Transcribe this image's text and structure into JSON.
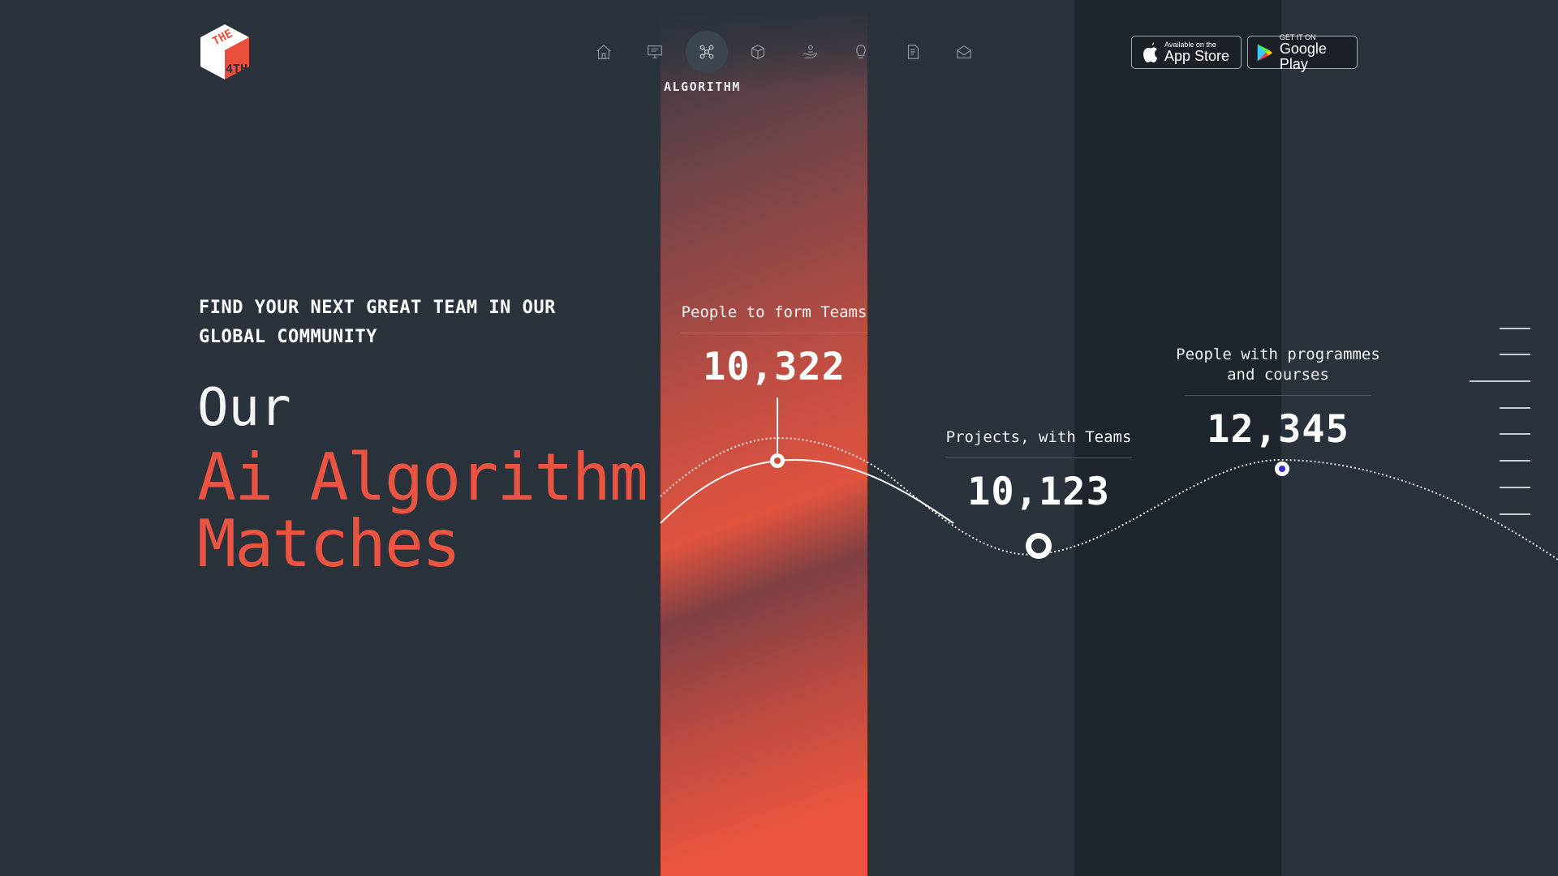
{
  "nav": {
    "items": [
      {
        "icon": "home-icon",
        "label": ""
      },
      {
        "icon": "monitor-icon",
        "label": ""
      },
      {
        "icon": "algorithm-icon",
        "label": "ALGORITHM",
        "active": true
      },
      {
        "icon": "cube-icon",
        "label": ""
      },
      {
        "icon": "hand-user-icon",
        "label": ""
      },
      {
        "icon": "lightbulb-icon",
        "label": ""
      },
      {
        "icon": "document-icon",
        "label": ""
      },
      {
        "icon": "envelope-icon",
        "label": ""
      }
    ],
    "active_label": "ALGORITHM"
  },
  "stores": {
    "appstore_small": "Available on the",
    "appstore_big": "App Store",
    "playstore_small": "GET IT ON",
    "playstore_big": "Google Play"
  },
  "logo": {
    "text_top": "THE",
    "text_bottom": "4TH"
  },
  "hero": {
    "eyebrow": "FIND YOUR NEXT GREAT TEAM IN OUR GLOBAL COMMUNITY",
    "line1": "Our",
    "line2": "Ai Algorithm Matches"
  },
  "stats": [
    {
      "label": "People to form Teams",
      "value": "10,322"
    },
    {
      "label": "Projects, with Teams",
      "value": "10,123"
    },
    {
      "label": "People with programmes and courses",
      "value": "12,345"
    }
  ],
  "colors": {
    "background": "#2a323c",
    "accent": "#ea5440",
    "dot_blue": "#3b2ccf"
  }
}
